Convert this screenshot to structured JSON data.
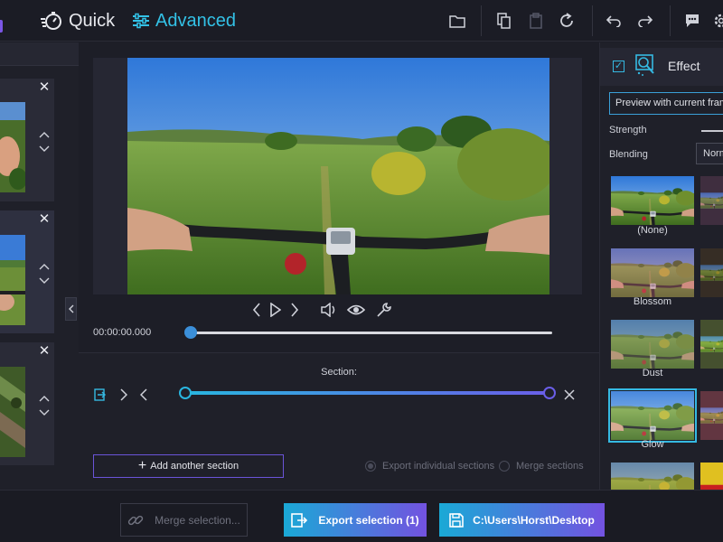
{
  "topbar": {
    "quick_label": "Quick",
    "advanced_label": "Advanced",
    "active_mode": "Advanced",
    "accent_color": "#33c1e6"
  },
  "clips": [
    {
      "icon": "clip-thumbnail",
      "selected": false
    },
    {
      "icon": "clip-thumbnail",
      "selected": true
    },
    {
      "icon": "clip-thumbnail",
      "selected": false
    }
  ],
  "player": {
    "time": "00:00:00.000",
    "position": 0
  },
  "sections": {
    "label": "Section:",
    "add_label": "Add another section",
    "export_individual_label": "Export individual sections",
    "merge_sections_label": "Merge sections",
    "selected_option": "Export individual sections"
  },
  "effects": {
    "enabled": true,
    "title": "Effect",
    "preview_label": "Preview with current frame",
    "strength_label": "Strength",
    "blending_label": "Blending",
    "blending_value": "Normal",
    "presets": [
      {
        "label": "(None)",
        "selected": false
      },
      {
        "label": "Blossom",
        "selected": false
      },
      {
        "label": "Dust",
        "selected": false
      },
      {
        "label": "Glow",
        "selected": true
      }
    ]
  },
  "bottombar": {
    "merge_label": "Merge selection...",
    "export_label": "Export selection (1)",
    "path_label": "C:\\Users\\Horst\\Desktop"
  }
}
